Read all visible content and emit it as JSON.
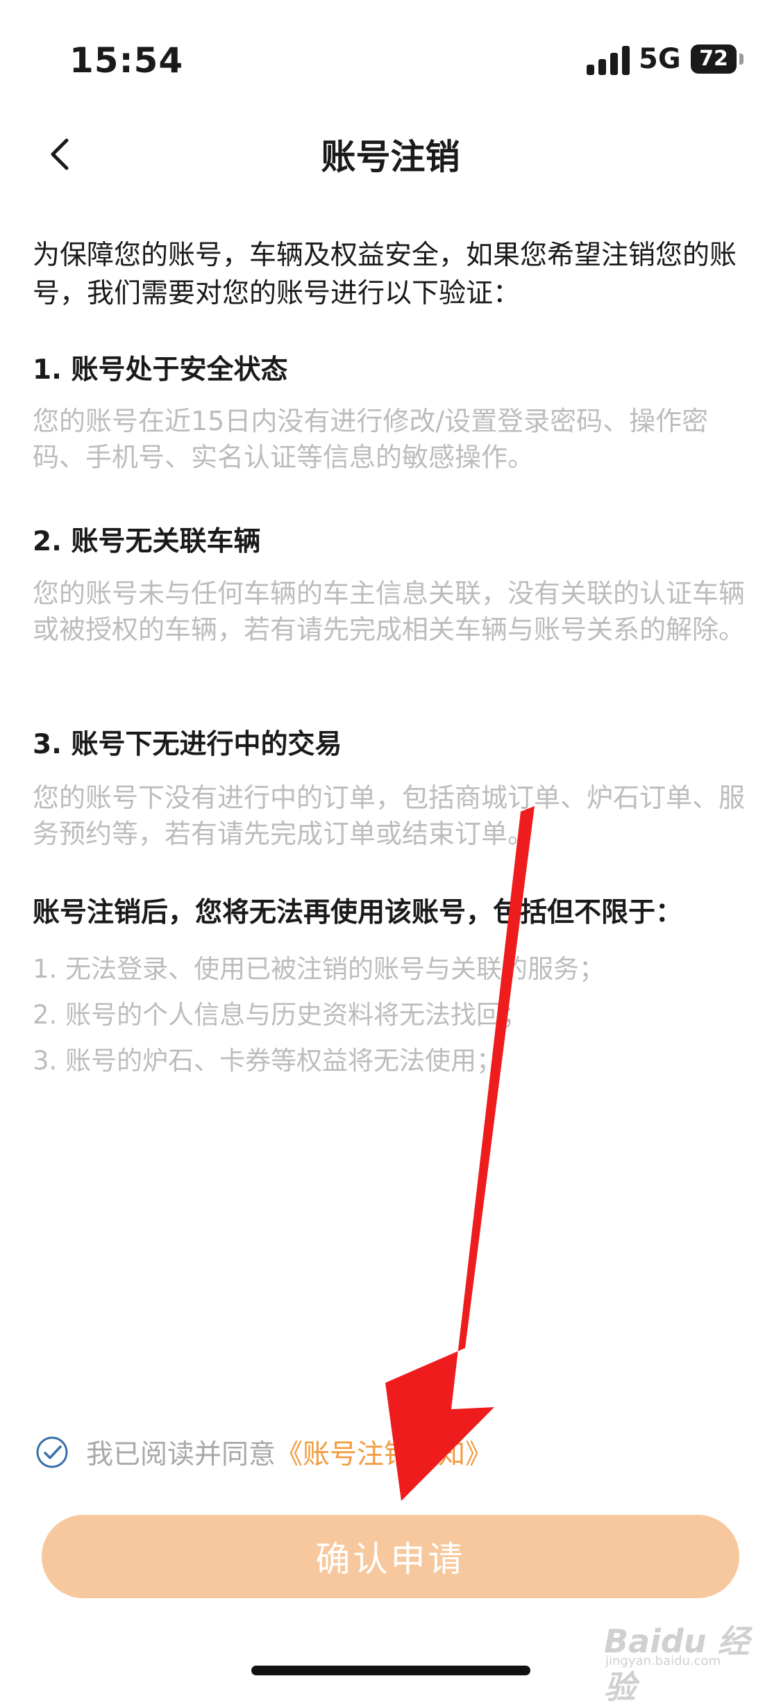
{
  "status_bar": {
    "time": "15:54",
    "network": "5G",
    "battery": "72"
  },
  "nav": {
    "title": "账号注销"
  },
  "intro": "为保障您的账号，车辆及权益安全，如果您希望注销您的账号，我们需要对您的账号进行以下验证：",
  "sections": [
    {
      "title": "1. 账号处于安全状态",
      "desc": "您的账号在近15日内没有进行修改/设置登录密码、操作密码、手机号、实名认证等信息的敏感操作。"
    },
    {
      "title": "2. 账号无关联车辆",
      "desc": "您的账号未与任何车辆的车主信息关联，没有关联的认证车辆或被授权的车辆，若有请先完成相关车辆与账号关系的解除。"
    },
    {
      "title": "3. 账号下无进行中的交易",
      "desc": "您的账号下没有进行中的订单，包括商城订单、炉石订单、服务预约等，若有请先完成订单或结束订单。"
    }
  ],
  "after": {
    "title": "账号注销后，您将无法再使用该账号，包括但不限于：",
    "items": [
      "1. 无法登录、使用已被注销的账号与关联的服务；",
      "2. 账号的个人信息与历史资料将无法找回；",
      "3. 账号的炉石、卡券等权益将无法使用；"
    ]
  },
  "agreement": {
    "text": "我已阅读并同意",
    "link": "《账号注销须知》",
    "checked": true
  },
  "confirm_button": "确认申请",
  "watermark": {
    "brand": "Baidu 经验",
    "sub": "jingyan.baidu.com"
  },
  "colors": {
    "accent": "#f39a3c",
    "button_bg": "#f7c89e",
    "arrow": "#ee1c1c",
    "muted_text": "#bcbcbc"
  }
}
